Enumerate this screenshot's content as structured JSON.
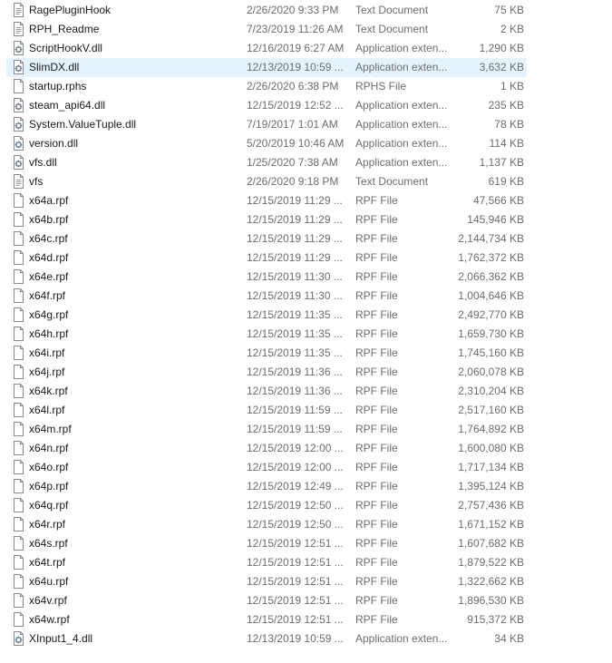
{
  "files": [
    {
      "name": "RagePluginHook",
      "date": "2/26/2020 9:33 PM",
      "type": "Text Document",
      "size": "75 KB",
      "icon": "text-file-icon"
    },
    {
      "name": "RPH_Readme",
      "date": "7/23/2019 11:26 AM",
      "type": "Text Document",
      "size": "2 KB",
      "icon": "text-file-icon"
    },
    {
      "name": "ScriptHookV.dll",
      "date": "12/16/2019 6:27 AM",
      "type": "Application exten...",
      "size": "1,290 KB",
      "icon": "dll-file-icon"
    },
    {
      "name": "SlimDX.dll",
      "date": "12/13/2019 10:59 ...",
      "type": "Application exten...",
      "size": "3,632 KB",
      "icon": "dll-file-icon",
      "selected": true
    },
    {
      "name": "startup.rphs",
      "date": "2/26/2020 6:38 PM",
      "type": "RPHS File",
      "size": "1 KB",
      "icon": "blank-file-icon"
    },
    {
      "name": "steam_api64.dll",
      "date": "12/15/2019 12:52 ...",
      "type": "Application exten...",
      "size": "235 KB",
      "icon": "dll-file-icon"
    },
    {
      "name": "System.ValueTuple.dll",
      "date": "7/19/2017 1:01 AM",
      "type": "Application exten...",
      "size": "78 KB",
      "icon": "dll-file-icon"
    },
    {
      "name": "version.dll",
      "date": "5/20/2019 10:46 AM",
      "type": "Application exten...",
      "size": "114 KB",
      "icon": "dll-file-icon"
    },
    {
      "name": "vfs.dll",
      "date": "1/25/2020 7:38 AM",
      "type": "Application exten...",
      "size": "1,137 KB",
      "icon": "dll-file-icon"
    },
    {
      "name": "vfs",
      "date": "2/26/2020 9:18 PM",
      "type": "Text Document",
      "size": "619 KB",
      "icon": "text-file-icon"
    },
    {
      "name": "x64a.rpf",
      "date": "12/15/2019 11:29 ...",
      "type": "RPF File",
      "size": "47,566 KB",
      "icon": "blank-file-icon"
    },
    {
      "name": "x64b.rpf",
      "date": "12/15/2019 11:29 ...",
      "type": "RPF File",
      "size": "145,946 KB",
      "icon": "blank-file-icon"
    },
    {
      "name": "x64c.rpf",
      "date": "12/15/2019 11:29 ...",
      "type": "RPF File",
      "size": "2,144,734 KB",
      "icon": "blank-file-icon"
    },
    {
      "name": "x64d.rpf",
      "date": "12/15/2019 11:29 ...",
      "type": "RPF File",
      "size": "1,762,372 KB",
      "icon": "blank-file-icon"
    },
    {
      "name": "x64e.rpf",
      "date": "12/15/2019 11:30 ...",
      "type": "RPF File",
      "size": "2,066,362 KB",
      "icon": "blank-file-icon"
    },
    {
      "name": "x64f.rpf",
      "date": "12/15/2019 11:30 ...",
      "type": "RPF File",
      "size": "1,004,646 KB",
      "icon": "blank-file-icon"
    },
    {
      "name": "x64g.rpf",
      "date": "12/15/2019 11:35 ...",
      "type": "RPF File",
      "size": "2,492,770 KB",
      "icon": "blank-file-icon"
    },
    {
      "name": "x64h.rpf",
      "date": "12/15/2019 11:35 ...",
      "type": "RPF File",
      "size": "1,659,730 KB",
      "icon": "blank-file-icon"
    },
    {
      "name": "x64i.rpf",
      "date": "12/15/2019 11:35 ...",
      "type": "RPF File",
      "size": "1,745,160 KB",
      "icon": "blank-file-icon"
    },
    {
      "name": "x64j.rpf",
      "date": "12/15/2019 11:36 ...",
      "type": "RPF File",
      "size": "2,060,078 KB",
      "icon": "blank-file-icon"
    },
    {
      "name": "x64k.rpf",
      "date": "12/15/2019 11:36 ...",
      "type": "RPF File",
      "size": "2,310,204 KB",
      "icon": "blank-file-icon"
    },
    {
      "name": "x64l.rpf",
      "date": "12/15/2019 11:59 ...",
      "type": "RPF File",
      "size": "2,517,160 KB",
      "icon": "blank-file-icon"
    },
    {
      "name": "x64m.rpf",
      "date": "12/15/2019 11:59 ...",
      "type": "RPF File",
      "size": "1,764,892 KB",
      "icon": "blank-file-icon"
    },
    {
      "name": "x64n.rpf",
      "date": "12/15/2019 12:00 ...",
      "type": "RPF File",
      "size": "1,600,080 KB",
      "icon": "blank-file-icon"
    },
    {
      "name": "x64o.rpf",
      "date": "12/15/2019 12:00 ...",
      "type": "RPF File",
      "size": "1,717,134 KB",
      "icon": "blank-file-icon"
    },
    {
      "name": "x64p.rpf",
      "date": "12/15/2019 12:49 ...",
      "type": "RPF File",
      "size": "1,395,124 KB",
      "icon": "blank-file-icon"
    },
    {
      "name": "x64q.rpf",
      "date": "12/15/2019 12:50 ...",
      "type": "RPF File",
      "size": "2,757,436 KB",
      "icon": "blank-file-icon"
    },
    {
      "name": "x64r.rpf",
      "date": "12/15/2019 12:50 ...",
      "type": "RPF File",
      "size": "1,671,152 KB",
      "icon": "blank-file-icon"
    },
    {
      "name": "x64s.rpf",
      "date": "12/15/2019 12:51 ...",
      "type": "RPF File",
      "size": "1,607,682 KB",
      "icon": "blank-file-icon"
    },
    {
      "name": "x64t.rpf",
      "date": "12/15/2019 12:51 ...",
      "type": "RPF File",
      "size": "1,879,522 KB",
      "icon": "blank-file-icon"
    },
    {
      "name": "x64u.rpf",
      "date": "12/15/2019 12:51 ...",
      "type": "RPF File",
      "size": "1,322,662 KB",
      "icon": "blank-file-icon"
    },
    {
      "name": "x64v.rpf",
      "date": "12/15/2019 12:51 ...",
      "type": "RPF File",
      "size": "1,896,530 KB",
      "icon": "blank-file-icon"
    },
    {
      "name": "x64w.rpf",
      "date": "12/15/2019 12:51 ...",
      "type": "RPF File",
      "size": "915,372 KB",
      "icon": "blank-file-icon"
    },
    {
      "name": "XInput1_4.dll",
      "date": "12/13/2019 10:59 ...",
      "type": "Application exten...",
      "size": "34 KB",
      "icon": "dll-file-icon"
    }
  ],
  "colors": {
    "selection": "#e5f3ff",
    "secondary_text": "#6d6d6d",
    "primary_text": "#1a1a1a"
  }
}
